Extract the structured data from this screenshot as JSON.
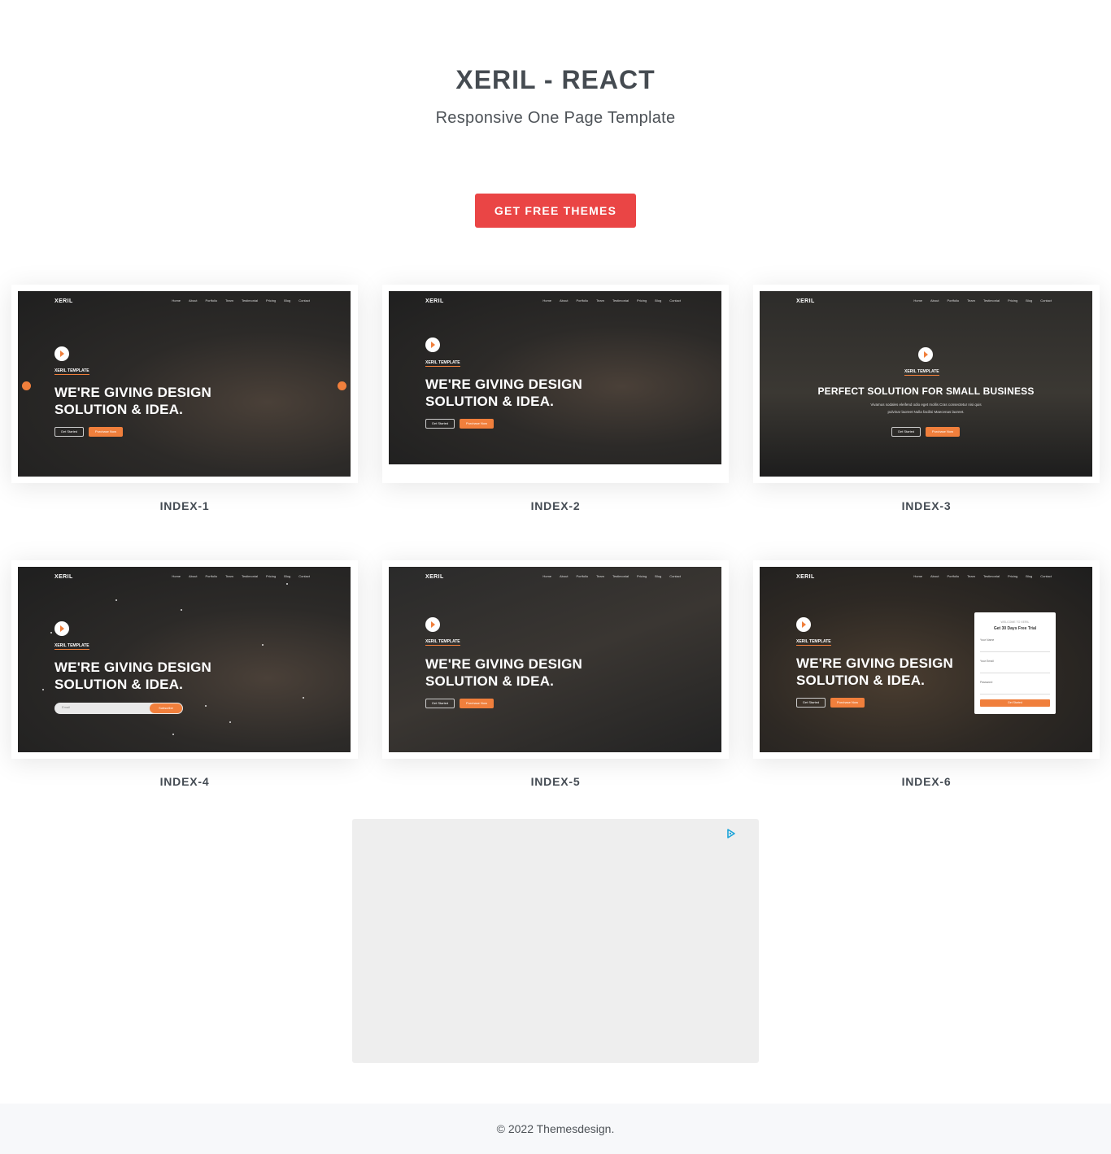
{
  "hero": {
    "title": "XERIL - REACT",
    "subtitle": "Responsive One Page Template",
    "cta_label": "GET FREE THEMES"
  },
  "preview": {
    "logo": "XERIL",
    "nav": [
      "Home",
      "About",
      "Portfolio",
      "Team",
      "Testimonial",
      "Pricing",
      "Blog",
      "Contact"
    ],
    "kicker": "XERIL TEMPLATE",
    "headline_1": "WE'RE GIVING DESIGN",
    "headline_2": "SOLUTION & IDEA.",
    "btn_outline": "Get Started",
    "btn_filled": "Purchase Now",
    "alt_headline": "PERFECT SOLUTION FOR SMALL BUSINESS",
    "alt_sub_1": "Vivamus sodales eleifend odio eget mollis Cras consectetur nisi quis",
    "alt_sub_2": "pulvinar laoreet Nulla facilisi Maecenas laoreet.",
    "email_placeholder": "Email",
    "subscribe": "Subscribe",
    "form_kicker": "WELCOME TO XERIL",
    "form_title": "Get 30 Days Free Trial",
    "form_name": "Your Name",
    "form_email": "Your Email",
    "form_password": "Password",
    "form_submit": "Get Started"
  },
  "cards": [
    {
      "label": "INDEX-1"
    },
    {
      "label": "INDEX-2"
    },
    {
      "label": "INDEX-3"
    },
    {
      "label": "INDEX-4"
    },
    {
      "label": "INDEX-5"
    },
    {
      "label": "INDEX-6"
    }
  ],
  "footer": {
    "copyright": "© 2022 Themesdesign."
  },
  "colors": {
    "accent": "#ea4545",
    "orange": "#f07f3c",
    "dark": "#262626"
  }
}
